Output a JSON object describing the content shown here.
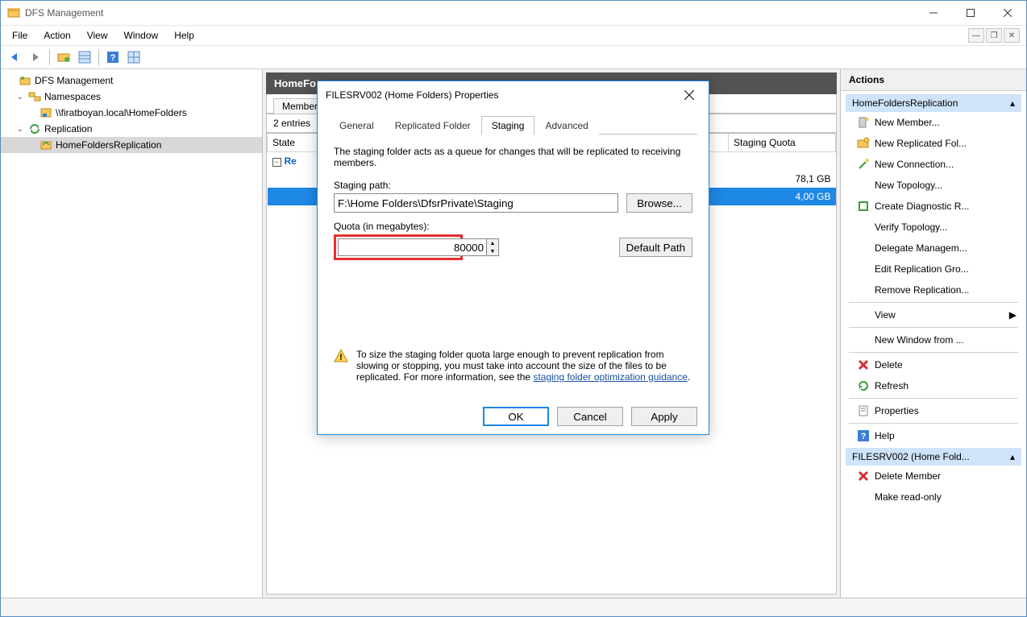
{
  "window": {
    "title": "DFS Management"
  },
  "menu": [
    "File",
    "Action",
    "View",
    "Window",
    "Help"
  ],
  "tree": {
    "root": "DFS Management",
    "items": [
      {
        "label": "Namespaces",
        "children": [
          {
            "label": "\\\\firatboyan.local\\HomeFolders"
          }
        ]
      },
      {
        "label": "Replication",
        "children": [
          {
            "label": "HomeFoldersReplication"
          }
        ]
      }
    ]
  },
  "center": {
    "banner_label": "HomeFo",
    "tabs": [
      "Members"
    ],
    "entries_text": "2 entries",
    "columns": {
      "state": "State",
      "staging_quota": "Staging Quota"
    },
    "row1": {
      "state": "Re",
      "quota": "78,1 GB"
    },
    "row2": {
      "state": "",
      "quota": "4,00 GB"
    }
  },
  "actions": {
    "header": "Actions",
    "group1": {
      "title": "HomeFoldersReplication",
      "items": [
        "New Member...",
        "New Replicated Fol...",
        "New Connection...",
        "New Topology...",
        "Create Diagnostic R...",
        "Verify Topology...",
        "Delegate Managem...",
        "Edit Replication Gro...",
        "Remove Replication..."
      ],
      "view": "View",
      "new_window": "New Window from ...",
      "delete": "Delete",
      "refresh": "Refresh",
      "properties": "Properties",
      "help": "Help"
    },
    "group2": {
      "title": "FILESRV002 (Home Fold...",
      "delete_member": "Delete Member",
      "make_ro": "Make read-only"
    }
  },
  "dialog": {
    "title": "FILESRV002 (Home Folders) Properties",
    "tabs": [
      "General",
      "Replicated Folder",
      "Staging",
      "Advanced"
    ],
    "active_tab": "Staging",
    "intro": "The staging folder acts as a queue for changes that will be replicated to receiving members.",
    "staging_path_label": "Staging path:",
    "staging_path_value": "F:\\Home Folders\\DfsrPrivate\\Staging",
    "browse_label": "Browse...",
    "quota_label": "Quota (in megabytes):",
    "quota_value": "80000",
    "default_path_label": "Default Path",
    "warning_text": "To size the staging folder quota large enough to prevent replication from slowing or stopping, you must take into account the size of the files to be replicated. For more information, see the ",
    "warning_link": "staging folder optimization guidance",
    "buttons": {
      "ok": "OK",
      "cancel": "Cancel",
      "apply": "Apply"
    }
  }
}
